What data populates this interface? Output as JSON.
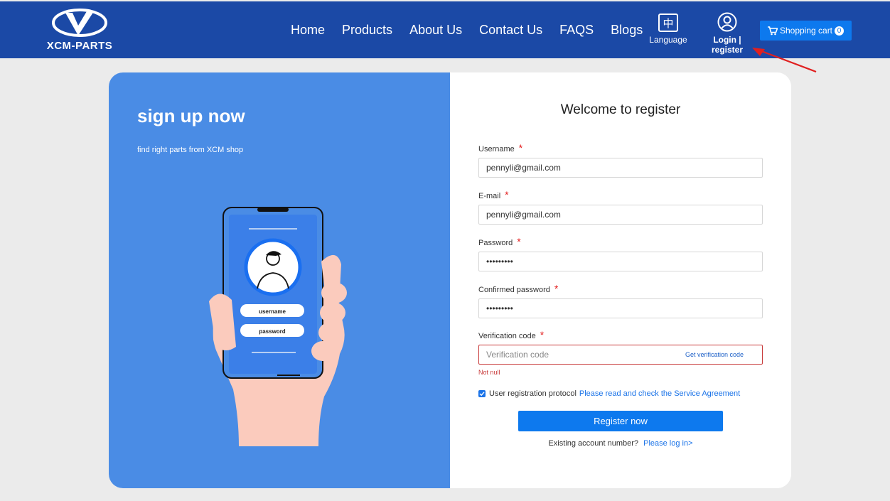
{
  "header": {
    "logo_text": "XCM-PARTS",
    "nav": [
      "Home",
      "Products",
      "About Us",
      "Contact Us",
      "FAQS",
      "Blogs"
    ],
    "language_icon_glyph": "中",
    "language_label": "Language",
    "login_label": "Login | register",
    "cart_label": "Shopping cart",
    "cart_count": "0"
  },
  "left": {
    "title": "sign up now",
    "subtitle": "find right parts from XCM shop",
    "illustration": {
      "username_label": "username",
      "password_label": "password"
    }
  },
  "form": {
    "title": "Welcome to register",
    "required_mark": "*",
    "username": {
      "label": "Username",
      "value": "pennyli@gmail.com"
    },
    "email": {
      "label": "E-mail",
      "value": "pennyli@gmail.com"
    },
    "password": {
      "label": "Password",
      "value": "•••••••••"
    },
    "confirm": {
      "label": "Confirmed password",
      "value": "•••••••••"
    },
    "verification": {
      "label": "Verification code",
      "placeholder": "Verification code",
      "get_code": "Get verification code",
      "error": "Not null"
    },
    "protocol_text": "User registration protocol",
    "protocol_link": "Please read and check the Service Agreement",
    "register_button": "Register now",
    "existing_text": "Existing account number?",
    "login_link": "Please log in>"
  },
  "colors": {
    "header_bg": "#1b49a6",
    "accent": "#0d79ee",
    "left_panel": "#4a8ce5",
    "error": "#c83a3a",
    "annotation_arrow": "#e02020"
  }
}
